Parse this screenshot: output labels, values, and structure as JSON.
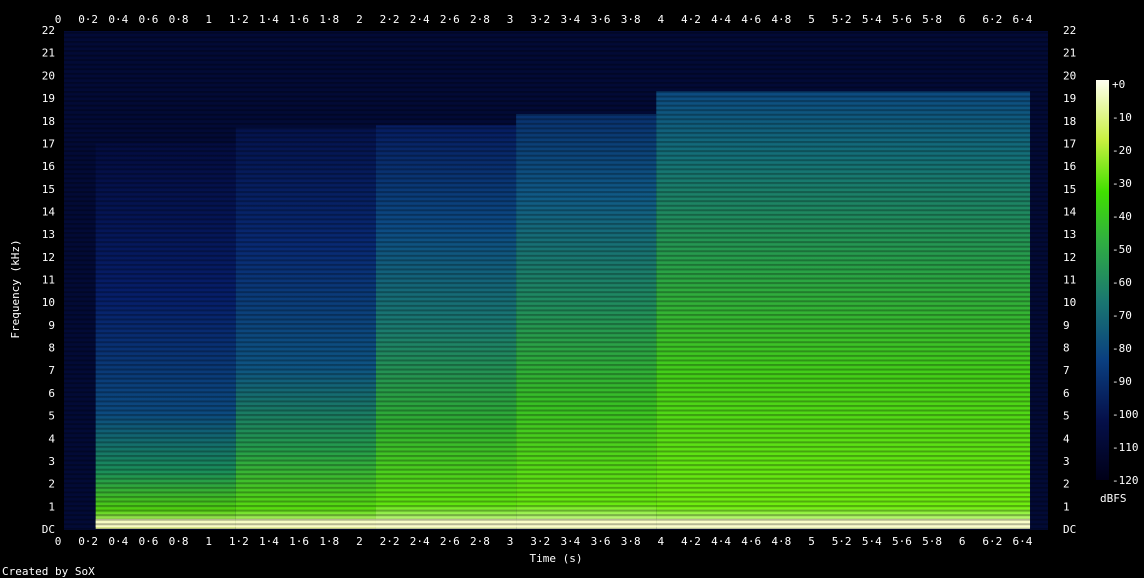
{
  "chart_data": {
    "type": "heatmap",
    "title": "",
    "xlabel": "Time (s)",
    "ylabel": "Frequency (kHz)",
    "xlim": [
      0,
      6.45
    ],
    "ylim": [
      0,
      22.05
    ],
    "x_ticks": [
      "0",
      "0·2",
      "0·4",
      "0·6",
      "0·8",
      "1",
      "1·2",
      "1·4",
      "1·6",
      "1·8",
      "2",
      "2·2",
      "2·4",
      "2·6",
      "2·8",
      "3",
      "3·2",
      "3·4",
      "3·6",
      "3·8",
      "4",
      "4·2",
      "4·4",
      "4·6",
      "4·8",
      "5",
      "5·2",
      "5·4",
      "5·6",
      "5·8",
      "6",
      "6·2",
      "6·4"
    ],
    "y_ticks": [
      "DC",
      "1",
      "2",
      "3",
      "4",
      "5",
      "6",
      "7",
      "8",
      "9",
      "10",
      "11",
      "12",
      "13",
      "14",
      "15",
      "16",
      "17",
      "18",
      "19",
      "20",
      "21",
      "22"
    ],
    "colorbar": {
      "label": "dBFS",
      "ticks": [
        "+0",
        "-10",
        "-20",
        "-30",
        "-40",
        "-50",
        "-60",
        "-70",
        "-80",
        "-90",
        "-100",
        "-110",
        "-120"
      ],
      "range": [
        -120,
        0
      ]
    },
    "segments": [
      {
        "t_start": 0.25,
        "t_end": 1.18,
        "cutoff_khz": 17.0
      },
      {
        "t_start": 1.18,
        "t_end": 2.11,
        "cutoff_khz": 17.7
      },
      {
        "t_start": 2.11,
        "t_end": 3.04,
        "cutoff_khz": 17.8
      },
      {
        "t_start": 3.04,
        "t_end": 3.97,
        "cutoff_khz": 18.3
      },
      {
        "t_start": 3.97,
        "t_end": 6.45,
        "cutoff_khz": 19.3
      }
    ],
    "colors": {
      "low": "#000030",
      "mid": "#0a3f80",
      "high": "#40e000",
      "peak": "#fffdd0"
    }
  },
  "footer": {
    "credit": "Created by SoX"
  }
}
